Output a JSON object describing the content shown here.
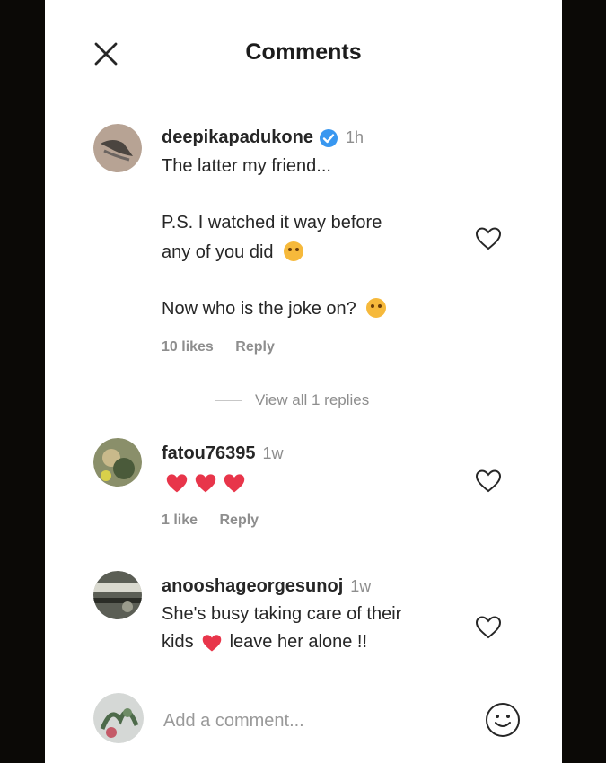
{
  "header": {
    "title": "Comments",
    "close_icon": "close-icon"
  },
  "comments": [
    {
      "username": "deepikapadukone",
      "verified": true,
      "time": "1h",
      "lines": [
        "The latter my friend...",
        "P.S. I watched it way before",
        "any of you did",
        "Now who is the joke on?"
      ],
      "likes": "10 likes",
      "reply": "Reply",
      "view_replies": "View all 1 replies"
    },
    {
      "username": "fatou76395",
      "time": "1w",
      "hearts": 3,
      "likes": "1 like",
      "reply": "Reply"
    },
    {
      "username": "anooshageorgesunoj",
      "time": "1w",
      "lines": [
        "She's busy taking care of their",
        "kids",
        "leave her alone !!"
      ]
    }
  ],
  "composer": {
    "placeholder": "Add a comment..."
  },
  "colors": {
    "heart": "#e8354a",
    "verified": "#3897f0",
    "muted": "#8e8e8e"
  }
}
